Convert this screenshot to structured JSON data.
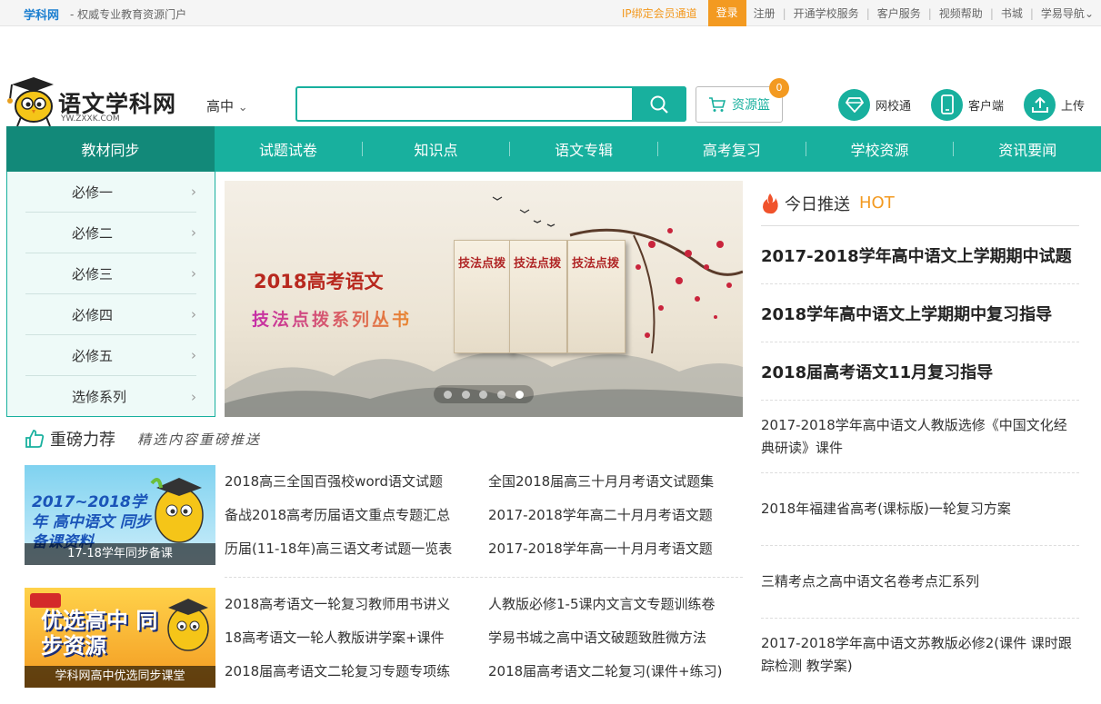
{
  "topbar": {
    "brand": "学科网",
    "slogan": "- 权威专业教育资源门户",
    "bind_link": "IP绑定会员通道",
    "login": "登录",
    "links": [
      "注册",
      "开通学校服务",
      "客户服务",
      "视频帮助",
      "书城",
      "学易导航"
    ]
  },
  "logo": {
    "title": "语文学科网",
    "sub": "YW.ZXXK.COM"
  },
  "grade": {
    "label": "高中"
  },
  "search": {
    "placeholder": ""
  },
  "basket": {
    "label": "资源篮",
    "count": "0"
  },
  "header_icons": [
    {
      "label": "网校通",
      "icon": "diamond-icon"
    },
    {
      "label": "客户端",
      "icon": "phone-icon"
    },
    {
      "label": "上传",
      "icon": "upload-icon"
    }
  ],
  "nav": [
    "教材同步",
    "试题试卷",
    "知识点",
    "语文专辑",
    "高考复习",
    "学校资源",
    "资讯要闻"
  ],
  "sidebar": [
    "必修一",
    "必修二",
    "必修三",
    "必修四",
    "必修五",
    "选修系列"
  ],
  "banner": {
    "title": "2018高考语文",
    "series": "技法点拨系列丛书",
    "books": [
      "技法点拨",
      "技法点拨",
      "技法点拨"
    ]
  },
  "recommend": {
    "title": "重磅力荐",
    "subtitle": "精选内容重磅推送",
    "blocks": [
      {
        "caption": "17-18学年同步备课",
        "image_text": "2017~2018学年 高中语文 同步备课资料",
        "items": [
          "2018高三全国百强校word语文试题",
          "全国2018届高三十月月考语文试题集",
          "备战2018高考历届语文重点专题汇总",
          "2017-2018学年高二十月月考语文题",
          "历届(11-18年)高三语文考试题一览表",
          "2017-2018学年高一十月月考语文题"
        ]
      },
      {
        "caption": "学科网高中优选同步课堂",
        "image_text": "优选高中 同步资源",
        "items": [
          "2018高考语文一轮复习教师用书讲义",
          "人教版必修1-5课内文言文专题训练卷",
          "18高考语文一轮人教版讲学案+课件",
          "学易书城之高中语文破题致胜微方法",
          "2018届高考语文二轮复习专题专项练",
          "2018届高考语文二轮复习(课件+练习)"
        ]
      }
    ]
  },
  "today": {
    "title": "今日推送",
    "hot": "HOT",
    "bold_items": [
      "2017-2018学年高中语文上学期期中试题",
      "2018学年高中语文上学期期中复习指导",
      "2018届高考语文11月复习指导"
    ],
    "items": [
      "2017-2018学年高中语文人教版选修《中国文化经典研读》课件",
      "2018年福建省高考(课标版)一轮复习方案",
      "三精考点之高中语文名卷考点汇系列",
      "2017-2018学年高中语文苏教版必修2(课件 课时跟踪检测 教学案)"
    ]
  },
  "colors": {
    "accent": "#18b09e",
    "accent_dark": "#128979",
    "orange": "#f39a21"
  }
}
